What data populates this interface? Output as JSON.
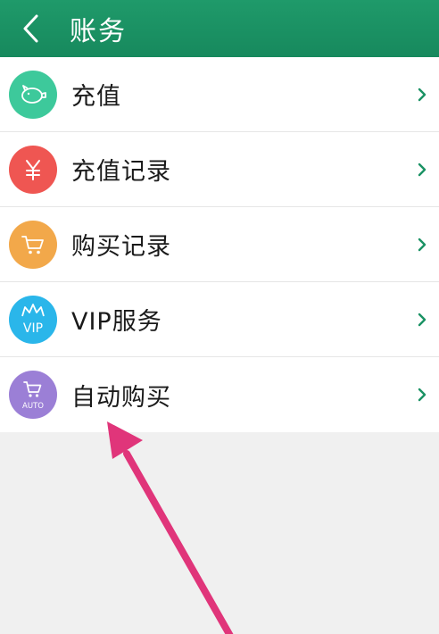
{
  "header": {
    "title": "账务",
    "background": "#1a9264"
  },
  "menu": {
    "items": [
      {
        "label": "充值",
        "icon": "piggy-bank-icon",
        "color": "#3dc99b"
      },
      {
        "label": "充值记录",
        "icon": "yuan-icon",
        "color": "#ef5652"
      },
      {
        "label": "购买记录",
        "icon": "cart-icon",
        "color": "#f2a84a"
      },
      {
        "label": "VIP服务",
        "icon": "vip-crown-icon",
        "icon_text": "VIP",
        "color": "#2ab6ea"
      },
      {
        "label": "自动购买",
        "icon": "auto-cart-icon",
        "icon_text": "AUTO",
        "color": "#9b7fd6"
      }
    ]
  },
  "annotation": {
    "arrow_color": "#e0357a"
  }
}
